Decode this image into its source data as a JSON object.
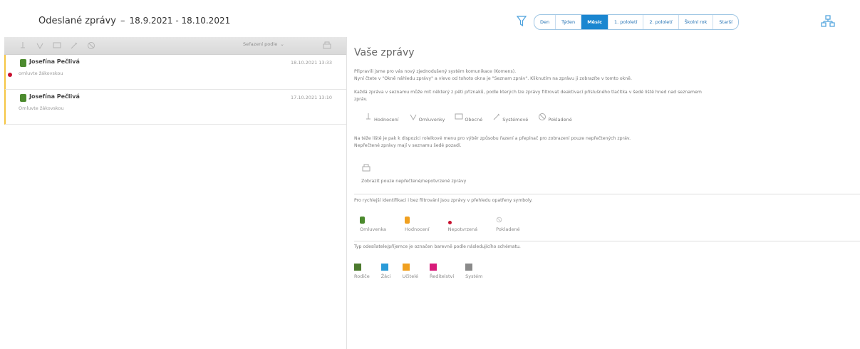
{
  "header": {
    "title": "Odeslané zprávy",
    "dash": "–",
    "range": "18.9.2021 - 18.10.2021"
  },
  "periods": [
    {
      "label": "Den",
      "active": false
    },
    {
      "label": "Týden",
      "active": false
    },
    {
      "label": "Měsíc",
      "active": true
    },
    {
      "label": "1. pololetí",
      "active": false
    },
    {
      "label": "2. pololetí",
      "active": false
    },
    {
      "label": "Školní rok",
      "active": false
    },
    {
      "label": "Starší",
      "active": false
    }
  ],
  "toolbar": {
    "sort_label": "Seřazení podle",
    "icons": [
      "rating-filter-icon",
      "excuse-filter-icon",
      "general-filter-icon",
      "system-filter-icon",
      "deleted-filter-icon"
    ]
  },
  "messages": [
    {
      "sender": "Josefína Pečlivá",
      "date": "18.10.2021 13:33",
      "preview": "omluvte žákovskou",
      "unread": true
    },
    {
      "sender": "Josefína Pečlivá",
      "date": "17.10.2021 13:10",
      "preview": "Omluvte žákovskou",
      "unread": false
    }
  ],
  "right": {
    "heading": "Vaše zprávy",
    "intro": [
      "Připravili jsme pro vás nový zjednodušený systém komunikace (Komens).",
      "Nyní čtete v \"Okně náhledu zprávy\" a vlevo od tohoto okna je \"Seznam zpráv\". Kliknutím na zprávu ji zobrazíte v tomto okně."
    ],
    "flags_text": [
      "Každá zpráva v seznamu může mít některý z pěti příznaků, podle kterých lze zprávy filtrovat deaktivací příslušného tlačítka v šedé liště hned nad seznamem",
      "zpráv."
    ],
    "flag_icons": [
      {
        "icon": "rating-icon",
        "label": "Hodnocení"
      },
      {
        "icon": "excuse-icon",
        "label": "Omluvenky"
      },
      {
        "icon": "general-icon",
        "label": "Obecné"
      },
      {
        "icon": "system-icon",
        "label": "Systémové"
      },
      {
        "icon": "deleted-icon",
        "label": "Pokladené"
      }
    ],
    "menu_text": [
      "Na téže liště je pak k dispozici rolelkové menu pro výběr způsobu řazení a přepínač pro zobrazení pouze nepřečtených zpráv.",
      "Nepřečtené zprávy mají v seznamu šedé pozadí."
    ],
    "unread_toggle_label": "Zobrazit pouze nepřečtené/nepotvrzené zprávy",
    "symbols_text": "Pro rychlejší identifikaci i bez filtrování jsou zprávy v přehledu opatřeny symboly.",
    "symbols": [
      {
        "icon": "excuse-badge-icon",
        "label": "Omluvenka",
        "color": "#4c8a2e"
      },
      {
        "icon": "rating-badge-icon",
        "label": "Hodnocení",
        "color": "#f0a020"
      },
      {
        "icon": "unread-dot-icon",
        "label": "Nepotvrzená",
        "color": "#c8102e"
      },
      {
        "icon": "deleted-icon",
        "label": "Pokladené",
        "color": "#bbbbbb"
      }
    ],
    "sender_text": "Typ odesílatele/příjemce je označen barevně podle následujícího schématu.",
    "sender_types": [
      {
        "label": "Rodiče",
        "color": "#4c7a2e"
      },
      {
        "label": "Žáci",
        "color": "#2a9bd8"
      },
      {
        "label": "Učitelé",
        "color": "#f0a020"
      },
      {
        "label": "Ředitelství",
        "color": "#d81b7a"
      },
      {
        "label": "Systém",
        "color": "#8a8a8a"
      }
    ]
  }
}
